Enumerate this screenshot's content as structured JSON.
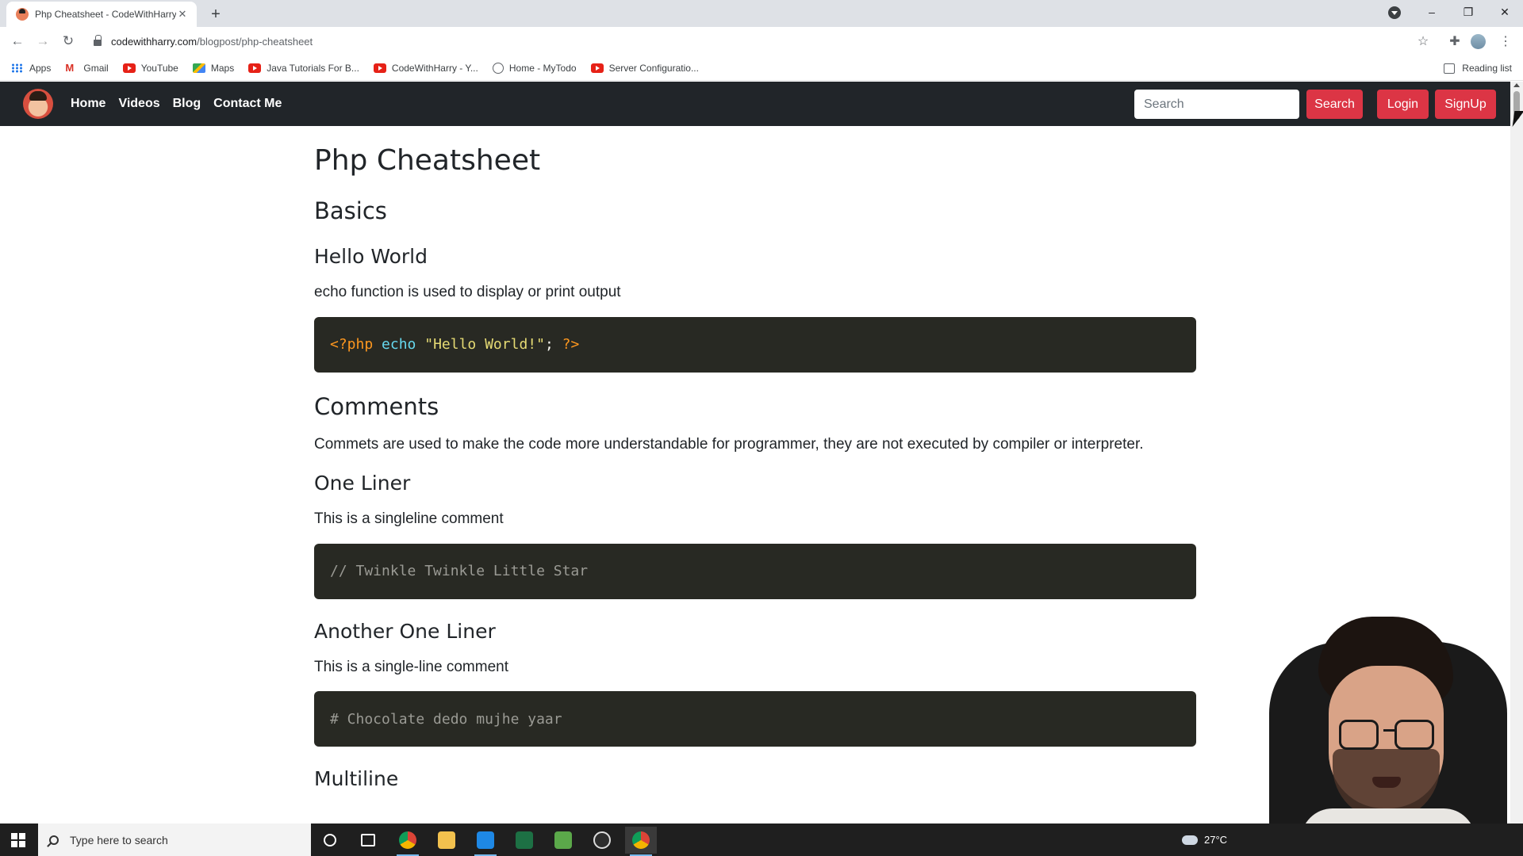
{
  "browser": {
    "tab_title": "Php Cheatsheet - CodeWithHarry",
    "tab_close": "✕",
    "new_tab": "+",
    "url_host": "codewithharry.com",
    "url_path": "/blogpost/php-cheatsheet",
    "window_controls": {
      "minimize": "–",
      "restore": "❐",
      "close": "✕"
    },
    "bookmarks": [
      {
        "label": "Apps",
        "icon": "apps-icon"
      },
      {
        "label": "Gmail",
        "icon": "gmail-icon"
      },
      {
        "label": "YouTube",
        "icon": "youtube-icon"
      },
      {
        "label": "Maps",
        "icon": "maps-icon"
      },
      {
        "label": "Java Tutorials For B...",
        "icon": "youtube-icon"
      },
      {
        "label": "CodeWithHarry - Y...",
        "icon": "youtube-icon"
      },
      {
        "label": "Home - MyTodo",
        "icon": "globe-icon"
      },
      {
        "label": "Server Configuratio...",
        "icon": "youtube-icon"
      }
    ],
    "reading_list": "Reading list"
  },
  "site": {
    "nav": {
      "links": [
        "Home",
        "Videos",
        "Blog",
        "Contact Me"
      ],
      "search_placeholder": "Search",
      "search_button": "Search",
      "login": "Login",
      "signup": "SignUp",
      "accent_color": "#dc3545",
      "bg_color": "#212529"
    },
    "article": {
      "title": "Php Cheatsheet",
      "basics": "Basics",
      "hello_world": {
        "heading": "Hello World",
        "text": "echo function is used to display or print output",
        "code": {
          "open_tag": "<?php",
          "fn": "echo",
          "str": "\"Hello World!\"",
          "semi": ";",
          "close_tag": "?>"
        }
      },
      "comments": {
        "heading": "Comments",
        "text": "Commets are used to make the code more understandable for programmer, they are not executed by compiler or interpreter."
      },
      "one_liner": {
        "heading": "One Liner",
        "text": "This is a singleline comment",
        "code": "// Twinkle Twinkle Little Star"
      },
      "another_one_liner": {
        "heading": "Another One Liner",
        "text": "This is a single-line comment",
        "code": "# Chocolate dedo mujhe yaar"
      },
      "multiline": {
        "heading": "Multiline"
      }
    }
  },
  "taskbar": {
    "search_placeholder": "Type here to search",
    "weather": "27°C",
    "apps": [
      "chrome-icon",
      "file-explorer-icon",
      "vscode-icon",
      "excel-icon",
      "notepad-icon",
      "obs-icon",
      "chrome-icon"
    ]
  }
}
